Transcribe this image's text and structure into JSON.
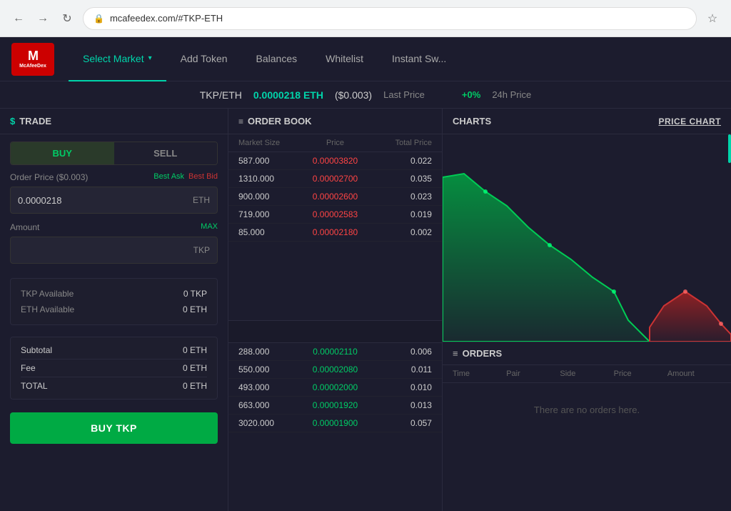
{
  "browser": {
    "url": "mcafeedex.com/#TKP-ETH",
    "back_label": "←",
    "forward_label": "→",
    "refresh_label": "↻"
  },
  "header": {
    "logo_line1": "McAfee",
    "logo_line2": "Dex",
    "nav": [
      {
        "id": "select-market",
        "label": "Select Market",
        "active": true,
        "has_chevron": true
      },
      {
        "id": "add-token",
        "label": "Add Token",
        "active": false
      },
      {
        "id": "balances",
        "label": "Balances",
        "active": false
      },
      {
        "id": "whitelist",
        "label": "Whitelist",
        "active": false
      },
      {
        "id": "instant-swap",
        "label": "Instant Sw...",
        "active": false
      }
    ]
  },
  "ticker": {
    "pair": "TKP/ETH",
    "price": "0.0000218 ETH",
    "price_usd": "($0.003)",
    "last_price_label": "Last Price",
    "change": "+0%",
    "change_label": "24h Price"
  },
  "trade": {
    "panel_title": "TRADE",
    "buy_label": "BUY",
    "sell_label": "SELL",
    "order_price_label": "Order Price ($0.003)",
    "best_ask_label": "Best Ask",
    "best_bid_label": "Best Bid",
    "order_price_value": "0.0000218",
    "order_price_suffix": "ETH",
    "amount_label": "Amount",
    "max_label": "MAX",
    "amount_suffix": "TKP",
    "tkp_available_label": "TKP Available",
    "tkp_available_value": "0 TKP",
    "eth_available_label": "ETH Available",
    "eth_available_value": "0 ETH",
    "subtotal_label": "Subtotal",
    "subtotal_value": "0 ETH",
    "fee_label": "Fee",
    "fee_value": "0 ETH",
    "total_label": "TOTAL",
    "total_value": "0 ETH",
    "buy_btn": "BUY TKP"
  },
  "orderbook": {
    "title": "ORDER BOOK",
    "col_market_size": "Market Size",
    "col_price": "Price",
    "col_total_price": "Total Price",
    "sell_orders": [
      {
        "market_size": "587.000",
        "price": "0.00003820",
        "total": "0.022"
      },
      {
        "market_size": "1310.000",
        "price": "0.00002700",
        "total": "0.035"
      },
      {
        "market_size": "900.000",
        "price": "0.00002600",
        "total": "0.023"
      },
      {
        "market_size": "719.000",
        "price": "0.00002583",
        "total": "0.019"
      },
      {
        "market_size": "85.000",
        "price": "0.00002180",
        "total": "0.002"
      }
    ],
    "buy_orders": [
      {
        "market_size": "288.000",
        "price": "0.00002110",
        "total": "0.006"
      },
      {
        "market_size": "550.000",
        "price": "0.00002080",
        "total": "0.011"
      },
      {
        "market_size": "493.000",
        "price": "0.00002000",
        "total": "0.010"
      },
      {
        "market_size": "663.000",
        "price": "0.00001920",
        "total": "0.013"
      },
      {
        "market_size": "3020.000",
        "price": "0.00001900",
        "total": "0.057"
      }
    ]
  },
  "charts": {
    "title": "CHARTS",
    "price_chart_label": "PRICE CHART"
  },
  "orders": {
    "title": "ORDERS",
    "cols": [
      "Time",
      "Pair",
      "Side",
      "Price",
      "Amount"
    ],
    "empty_message": "There are no orders here."
  }
}
